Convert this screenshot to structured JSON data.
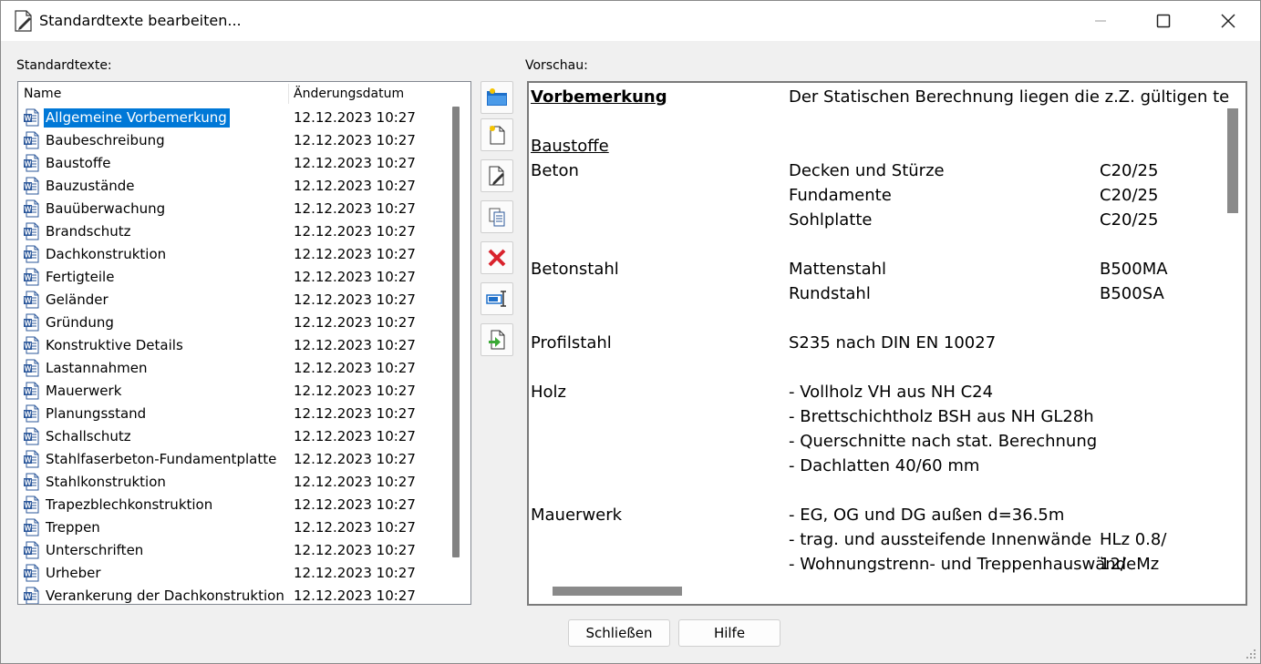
{
  "window": {
    "title": "Standardtexte bearbeiten..."
  },
  "left_label": "Standardtexte:",
  "right_label": "Vorschau:",
  "list": {
    "columns": [
      "Name",
      "Änderungsdatum"
    ],
    "selected_index": 0,
    "rows": [
      {
        "name": "Allgemeine Vorbemerkung",
        "date": "12.12.2023 10:27"
      },
      {
        "name": "Baubeschreibung",
        "date": "12.12.2023 10:27"
      },
      {
        "name": "Baustoffe",
        "date": "12.12.2023 10:27"
      },
      {
        "name": "Bauzustände",
        "date": "12.12.2023 10:27"
      },
      {
        "name": "Bauüberwachung",
        "date": "12.12.2023 10:27"
      },
      {
        "name": "Brandschutz",
        "date": "12.12.2023 10:27"
      },
      {
        "name": "Dachkonstruktion",
        "date": "12.12.2023 10:27"
      },
      {
        "name": "Fertigteile",
        "date": "12.12.2023 10:27"
      },
      {
        "name": "Geländer",
        "date": "12.12.2023 10:27"
      },
      {
        "name": "Gründung",
        "date": "12.12.2023 10:27"
      },
      {
        "name": "Konstruktive Details",
        "date": "12.12.2023 10:27"
      },
      {
        "name": "Lastannahmen",
        "date": "12.12.2023 10:27"
      },
      {
        "name": "Mauerwerk",
        "date": "12.12.2023 10:27"
      },
      {
        "name": "Planungsstand",
        "date": "12.12.2023 10:27"
      },
      {
        "name": "Schallschutz",
        "date": "12.12.2023 10:27"
      },
      {
        "name": "Stahlfaserbeton-Fundamentplatte",
        "date": "12.12.2023 10:27"
      },
      {
        "name": "Stahlkonstruktion",
        "date": "12.12.2023 10:27"
      },
      {
        "name": "Trapezblechkonstruktion",
        "date": "12.12.2023 10:27"
      },
      {
        "name": "Treppen",
        "date": "12.12.2023 10:27"
      },
      {
        "name": "Unterschriften",
        "date": "12.12.2023 10:27"
      },
      {
        "name": "Urheber",
        "date": "12.12.2023 10:27"
      },
      {
        "name": "Verankerung der Dachkonstruktion",
        "date": "12.12.2023 10:27"
      }
    ]
  },
  "toolbar": [
    {
      "name": "new-folder-button",
      "icon": "new-folder-icon"
    },
    {
      "name": "new-text-button",
      "icon": "new-document-icon"
    },
    {
      "name": "edit-text-button",
      "icon": "edit-document-icon"
    },
    {
      "name": "copy-text-button",
      "icon": "copy-icon"
    },
    {
      "name": "delete-text-button",
      "icon": "delete-icon"
    },
    {
      "name": "rename-text-button",
      "icon": "rename-icon"
    },
    {
      "name": "import-text-button",
      "icon": "import-icon"
    }
  ],
  "preview": {
    "lines": [
      {
        "c1": "Vorbemerkung",
        "c1_style": "bu",
        "c2": "Der Statischen Berechnung liegen die z.Z. gültigen te",
        "c3": ""
      },
      {
        "c1": "",
        "c2": "",
        "c3": ""
      },
      {
        "c1": "Baustoffe",
        "c1_style": "u",
        "c2": "",
        "c3": ""
      },
      {
        "c1": "Beton",
        "c2": "Decken und Stürze",
        "c3": "C20/25"
      },
      {
        "c1": "",
        "c2": "Fundamente",
        "c3": "C20/25"
      },
      {
        "c1": "",
        "c2": "Sohlplatte",
        "c3": "C20/25"
      },
      {
        "c1": "",
        "c2": "",
        "c3": ""
      },
      {
        "c1": "Betonstahl",
        "c2": "Mattenstahl",
        "c3": "B500MA"
      },
      {
        "c1": "",
        "c2": "Rundstahl",
        "c3": "B500SA"
      },
      {
        "c1": "",
        "c2": "",
        "c3": ""
      },
      {
        "c1": "Profilstahl",
        "c2": "S235 nach DIN EN 10027",
        "c3": ""
      },
      {
        "c1": "",
        "c2": "",
        "c3": ""
      },
      {
        "c1": "Holz",
        "c2": "- Vollholz VH aus NH C24",
        "c3": ""
      },
      {
        "c1": "",
        "c2": "- Brettschichtholz BSH aus NH GL28h",
        "c3": ""
      },
      {
        "c1": "",
        "c2": "- Querschnitte nach stat. Berechnung",
        "c3": ""
      },
      {
        "c1": "",
        "c2": "- Dachlatten 40/60 mm",
        "c3": ""
      },
      {
        "c1": "",
        "c2": "",
        "c3": ""
      },
      {
        "c1": "Mauerwerk",
        "c2": "- EG, OG und DG außen d=36.5m",
        "c3": ""
      },
      {
        "c1": "",
        "c2": "- trag. und aussteifende Innenwände",
        "c3": "HLz 0.8/"
      },
      {
        "c1": "",
        "c2": "- Wohnungstrenn- und TreppenhauswändeMz",
        "c3": "12/"
      }
    ]
  },
  "buttons": {
    "close": "Schließen",
    "help": "Hilfe"
  }
}
